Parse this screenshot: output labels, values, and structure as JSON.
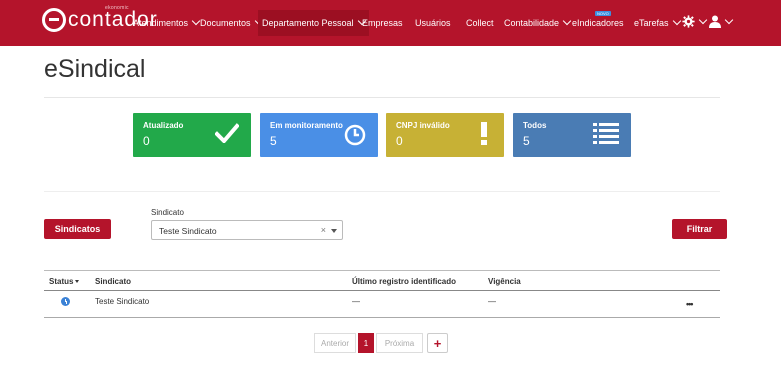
{
  "brand": {
    "name": "contador",
    "tagline": "ekonomic",
    "color": "#b4142b"
  },
  "nav": {
    "atendimentos": "Atendimentos",
    "documentos": "Documentos",
    "departamento": "Departamento Pessoal",
    "empresas": "Empresas",
    "usuarios": "Usuários",
    "collect": "Collect",
    "contabilidade": "Contabilidade",
    "eindicadores": "eIndicadores",
    "eindicadores_badge": "NOVO",
    "etarefas": "eTarefas",
    "settings_icon": "gear-icon",
    "user_icon": "user-icon"
  },
  "page": {
    "title": "eSindical"
  },
  "cards": [
    {
      "label": "Atualizado",
      "count": "0",
      "color": "#22a94a",
      "icon": "check-icon"
    },
    {
      "label": "Em monitoramento",
      "count": "5",
      "color": "#4a8fe6",
      "icon": "clock-icon"
    },
    {
      "label": "CNPJ inválido",
      "count": "0",
      "color": "#c7b135",
      "icon": "exclamation-icon"
    },
    {
      "label": "Todos",
      "count": "5",
      "color": "#4a7cb4",
      "icon": "list-icon"
    }
  ],
  "filters": {
    "sindicatos_button": "Sindicatos",
    "select_label": "Sindicato",
    "select_value": "Teste Sindicato",
    "clear": "×",
    "filtrar_button": "Filtrar"
  },
  "table": {
    "headers": [
      "Status",
      "Sindicato",
      "Último registro identificado",
      "Vigência"
    ],
    "rows": [
      {
        "status_icon": "info-icon",
        "sindicato": "Teste Sindicato",
        "ultimo": "—",
        "vigencia": "—",
        "actions": "•••"
      }
    ]
  },
  "pagination": {
    "prev": "Anterior",
    "current": "1",
    "next": "Próxima",
    "add": "+"
  }
}
